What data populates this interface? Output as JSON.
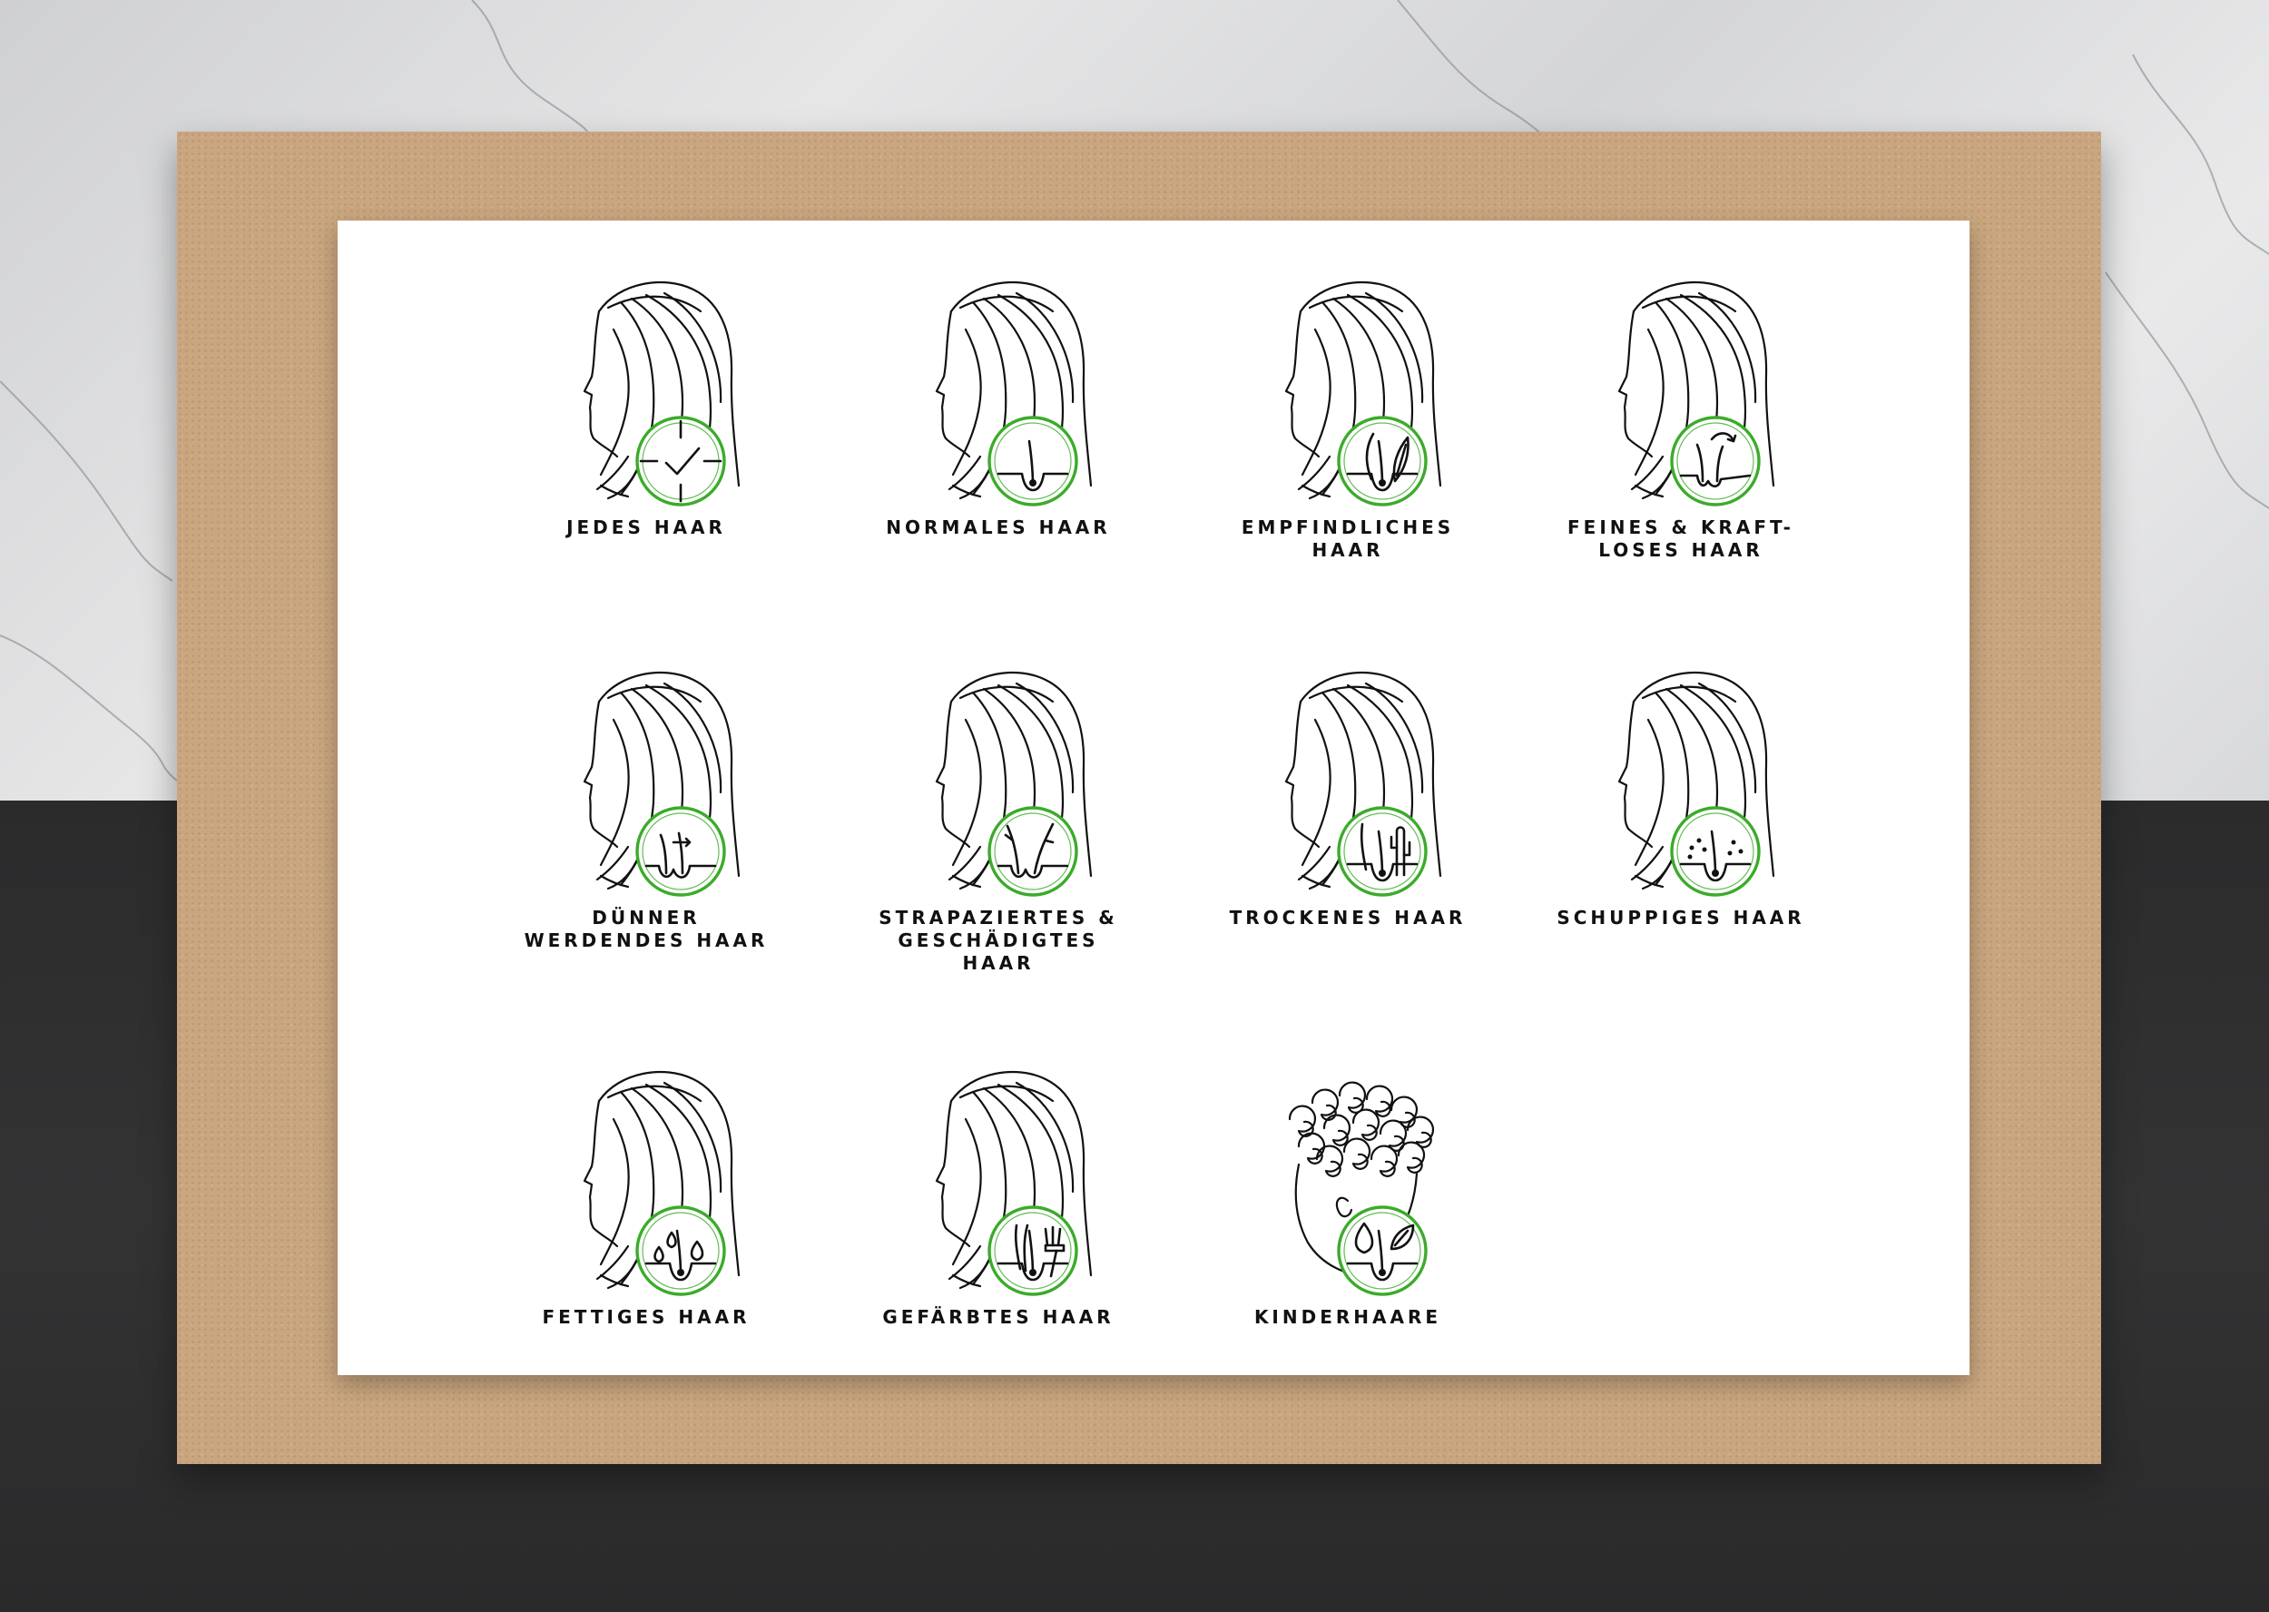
{
  "tiles": [
    {
      "label": "JEDES HAAR",
      "icon": "check-target-icon",
      "hair": "long"
    },
    {
      "label": "NORMALES HAAR",
      "icon": "single-hair-follicle-icon",
      "hair": "long"
    },
    {
      "label": "EMPFINDLICHES\nHAAR",
      "icon": "hair-with-feather-icon",
      "hair": "long"
    },
    {
      "label": "FEINES & KRAFT-\nLOSES HAAR",
      "icon": "thin-hair-arrow-icon",
      "hair": "long"
    },
    {
      "label": "DÜNNER\nWERDENDES HAAR",
      "icon": "thinning-hair-arrow-icon",
      "hair": "long"
    },
    {
      "label": "STRAPAZIERTES &\nGESCHÄDIGTES HAAR",
      "icon": "damaged-hair-icon",
      "hair": "long"
    },
    {
      "label": "TROCKENES HAAR",
      "icon": "hair-with-cactus-icon",
      "hair": "long"
    },
    {
      "label": "SCHUPPIGES HAAR",
      "icon": "hair-with-dandruff-icon",
      "hair": "long"
    },
    {
      "label": "FETTIGES HAAR",
      "icon": "hair-with-oil-drops-icon",
      "hair": "long"
    },
    {
      "label": "GEFÄRBTES HAAR",
      "icon": "hair-with-brush-icon",
      "hair": "long"
    },
    {
      "label": "KINDERHAARE",
      "icon": "hair-with-leaf-drop-icon",
      "hair": "curly"
    }
  ],
  "colors": {
    "accent": "#3cab2b",
    "line": "#111111"
  }
}
